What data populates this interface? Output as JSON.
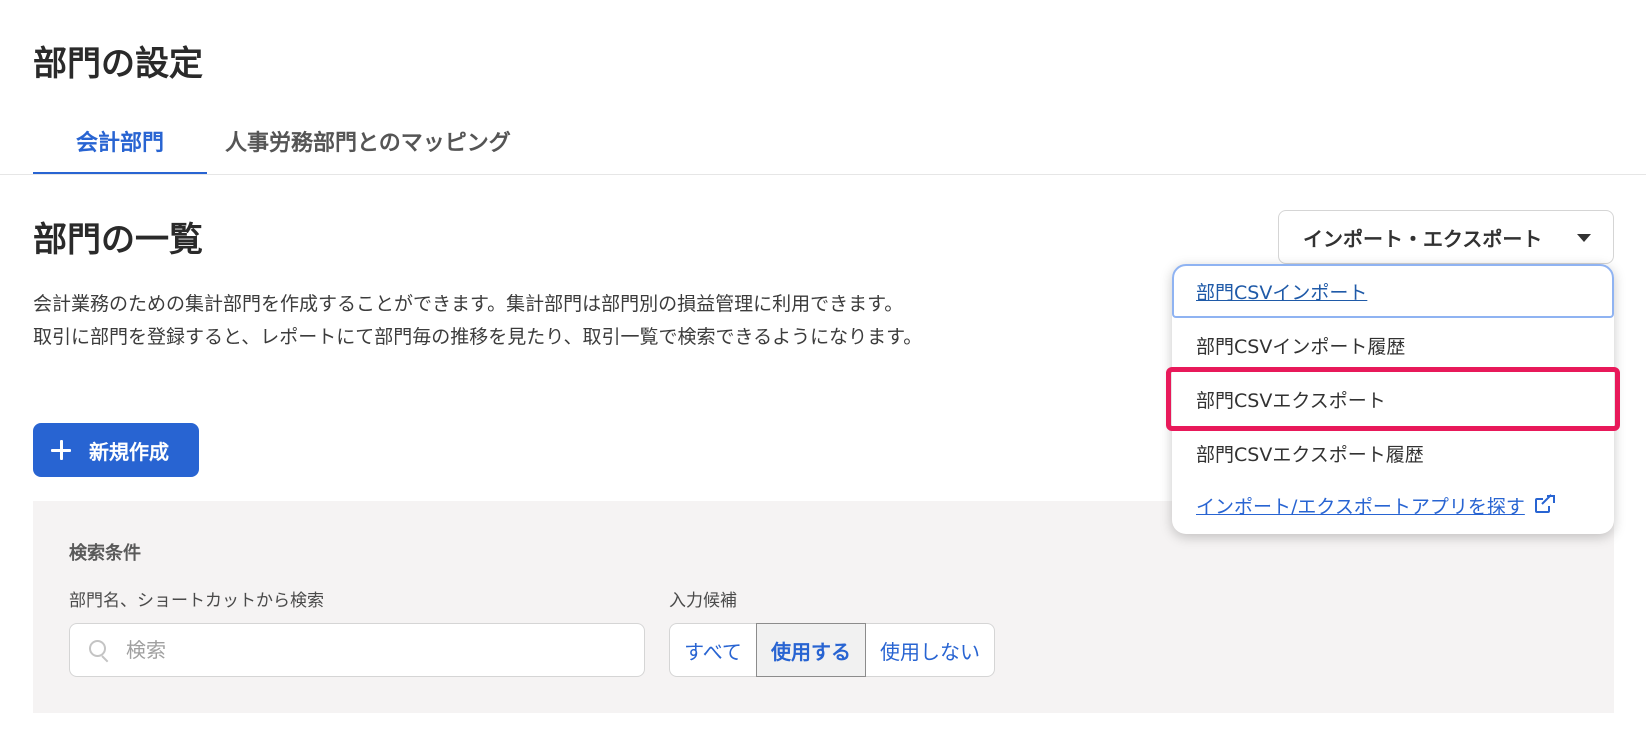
{
  "page": {
    "title": "部門の設定"
  },
  "tabs": [
    {
      "label": "会計部門",
      "active": true
    },
    {
      "label": "人事労務部門とのマッピング",
      "active": false
    }
  ],
  "section": {
    "title": "部門の一覧",
    "description_lines": [
      "会計業務のための集計部門を作成することができます。集計部門は部門別の損益管理に利用できます。",
      "取引に部門を登録すると、レポートにて部門毎の推移を見たり、取引一覧で検索できるようになります。"
    ]
  },
  "import_export": {
    "button_label": "インポート・エクスポート",
    "menu": [
      {
        "label": "部門CSVインポート",
        "style": "link",
        "focused": true
      },
      {
        "label": "部門CSVインポート履歴",
        "style": "plain"
      },
      {
        "label": "部門CSVエクスポート",
        "style": "plain",
        "highlighted": true
      },
      {
        "label": "部門CSVエクスポート履歴",
        "style": "plain"
      },
      {
        "label": "インポート/エクスポートアプリを探す",
        "style": "external",
        "icon": "external-link-icon"
      }
    ]
  },
  "new_button": {
    "label": "新規作成",
    "icon": "plus-icon"
  },
  "search": {
    "panel_title": "検索条件",
    "name_label": "部門名、ショートカットから検索",
    "placeholder": "検索",
    "value": "",
    "candidates_label": "入力候補",
    "options": [
      "すべて",
      "使用する",
      "使用しない"
    ],
    "selected": "使用する"
  },
  "colors": {
    "accent": "#2864d2",
    "highlight_border": "#e8195a",
    "panel_bg": "#f5f3f3"
  }
}
